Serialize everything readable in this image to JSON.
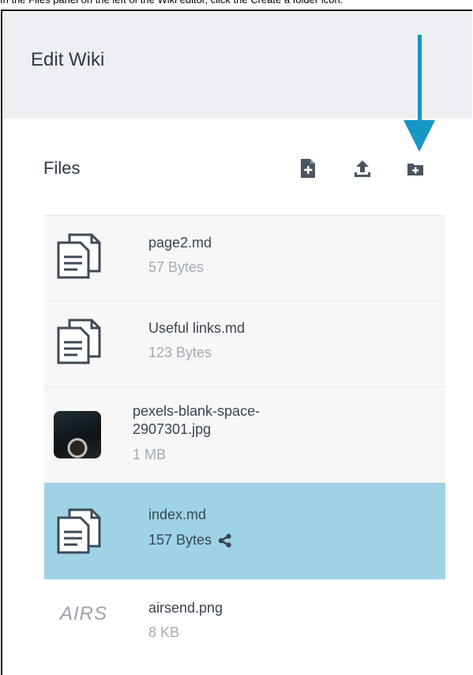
{
  "caption": "In the Files panel on the left of the Wiki editor, click the Create a folder icon.",
  "header": {
    "title": "Edit Wiki"
  },
  "files_panel": {
    "title": "Files",
    "toolbar": [
      {
        "icon": "new-file-icon"
      },
      {
        "icon": "upload-icon"
      },
      {
        "icon": "create-folder-icon"
      }
    ]
  },
  "files": [
    {
      "name": "page2.md",
      "size": "57 Bytes",
      "icon": "document-icon"
    },
    {
      "name": "Useful links.md",
      "size": "123 Bytes",
      "icon": "document-icon"
    },
    {
      "name_line1": "pexels-blank-space-",
      "name_line2": "2907301.jpg",
      "size": "1 MB",
      "icon": "image-thumbnail"
    },
    {
      "name": "index.md",
      "size": "157 Bytes",
      "icon": "document-icon",
      "selected": true,
      "shared": true
    },
    {
      "name": "airsend.png",
      "size": "8 KB",
      "icon": "image-thumbnail",
      "thumb_text": "AIRS"
    }
  ],
  "colors": {
    "selected_row": "#9ed3e6",
    "arrow": "#1596c4",
    "header_bg": "#eeeff2"
  }
}
